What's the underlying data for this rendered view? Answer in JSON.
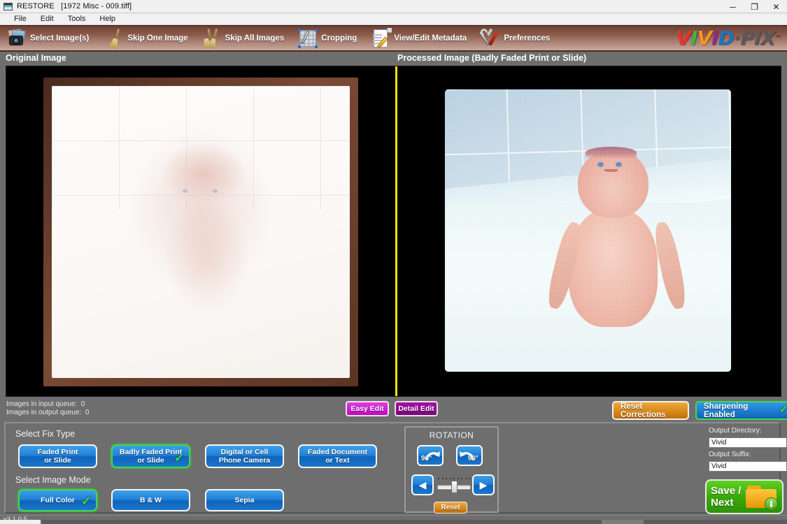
{
  "window": {
    "app_name": "RESTORE",
    "file_title": "[1972 Misc - 009.tiff]",
    "app_icon": "app-window-icon",
    "controls": {
      "minimize": "─",
      "restore": "❐",
      "close": "✕"
    }
  },
  "menubar": {
    "items": [
      {
        "label": "File"
      },
      {
        "label": "Edit"
      },
      {
        "label": "Tools"
      },
      {
        "label": "Help"
      }
    ]
  },
  "toolbar": {
    "items": [
      {
        "label": "Select Image(s)",
        "icon": "photos-camera-icon"
      },
      {
        "label": "Skip One Image",
        "icon": "broom-icon"
      },
      {
        "label": "Skip All Images",
        "icon": "double-broom-icon"
      },
      {
        "label": "Cropping",
        "icon": "crop-pen-icon"
      },
      {
        "label": "View/Edit Metadata",
        "icon": "document-pencil-icon"
      },
      {
        "label": "Preferences",
        "icon": "wrench-screwdriver-icon"
      }
    ]
  },
  "logo": {
    "letters": [
      {
        "ch": "V",
        "color": "#e8322a"
      },
      {
        "ch": "I",
        "color": "#3bb54a"
      },
      {
        "ch": "V",
        "color": "#f7941e"
      },
      {
        "ch": "I",
        "color": "#92278f"
      },
      {
        "ch": "D",
        "color": "#1c75bc"
      },
      {
        "ch": "·",
        "color": "#58595b"
      },
      {
        "ch": "P",
        "color": "#58595b"
      },
      {
        "ch": "I",
        "color": "#58595b"
      },
      {
        "ch": "X",
        "color": "#58595b"
      }
    ],
    "trademark": "™"
  },
  "panels": {
    "original_header": "Original Image",
    "processed_header": "Processed Image (Badly Faded Print or Slide)"
  },
  "queue": {
    "input_label": "Images in input queue:",
    "input_value": "0",
    "output_label": "Images in output queue:",
    "output_value": "0"
  },
  "edit_modes": {
    "easy": "Easy Edit",
    "detail": "Detail Edit",
    "selected": "Easy Edit"
  },
  "right_buttons": {
    "reset_corrections": "Reset Corrections",
    "sharpening": "Sharpening Enabled",
    "sharpening_checked": true,
    "check_glyph": "✓"
  },
  "fix_type": {
    "title": "Select Fix Type",
    "options": [
      {
        "line1": "Faded Print",
        "line2": "or Slide",
        "selected": false
      },
      {
        "line1": "Badly Faded Print",
        "line2": "or Slide",
        "selected": true
      },
      {
        "line1": "Digital or Cell",
        "line2": "Phone Camera",
        "selected": false
      },
      {
        "line1": "Faded Document",
        "line2": "or Text",
        "selected": false
      }
    ]
  },
  "image_mode": {
    "title": "Select Image Mode",
    "options": [
      {
        "line1": "Full Color",
        "line2": "",
        "selected": true
      },
      {
        "line1": "B & W",
        "line2": "",
        "selected": false
      },
      {
        "line1": "Sepia",
        "line2": "",
        "selected": false
      }
    ]
  },
  "rotation": {
    "title": "ROTATION",
    "ccw_label": "90°",
    "cw_label": "90°",
    "left_arrow": "◀",
    "right_arrow": "▶",
    "reset_label": "Reset",
    "slider_value": 0,
    "slider_ticks": 9
  },
  "output": {
    "directory_label": "Output Directory:",
    "directory_value": "Vivid",
    "suffix_label": "Output Suffix:",
    "suffix_value": "Vivid"
  },
  "save": {
    "line1": "Save /",
    "line2": "Next",
    "icon": "folder-download-icon",
    "arrow": "⬇"
  },
  "status": {
    "version": "v3.1.0.5"
  },
  "colors": {
    "accent_blue": "#1f7fd6",
    "selected_green": "#3ddc48",
    "orange": "#c26e06",
    "magenta": "#c206c2",
    "save_green": "#3aa80c",
    "divider_yellow": "#f5e500",
    "toolbar_brown": "#8b5a4a"
  }
}
